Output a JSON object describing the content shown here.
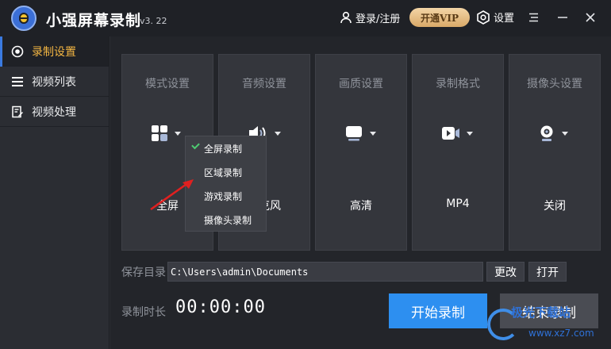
{
  "app": {
    "name": "小强屏幕录制",
    "version": "v3. 22"
  },
  "header": {
    "login": "登录/注册",
    "vip": "开通VIP",
    "settings": "设置"
  },
  "sidebar": {
    "items": [
      {
        "label": "录制设置",
        "icon": "record-circle-icon",
        "active": true
      },
      {
        "label": "视频列表",
        "icon": "list-icon",
        "active": false
      },
      {
        "label": "视频处理",
        "icon": "edit-doc-icon",
        "active": false
      }
    ]
  },
  "cards": [
    {
      "title": "模式设置",
      "value": "全屏",
      "icon": "grid-icon"
    },
    {
      "title": "音频设置",
      "value": "麦克风",
      "icon": "speaker-icon"
    },
    {
      "title": "画质设置",
      "value": "高清",
      "icon": "screen-icon"
    },
    {
      "title": "录制格式",
      "value": "MP4",
      "icon": "video-icon"
    },
    {
      "title": "摄像头设置",
      "value": "关闭",
      "icon": "webcam-icon"
    }
  ],
  "mode_dropdown": {
    "options": [
      "全屏录制",
      "区域录制",
      "游戏录制",
      "摄像头录制"
    ],
    "selected": "全屏录制"
  },
  "save": {
    "label": "保存目录",
    "path": "C:\\Users\\admin\\Documents",
    "change": "更改",
    "open": "打开"
  },
  "timer": {
    "label": "录制时长",
    "value": "00:00:00"
  },
  "actions": {
    "start": "开始录制",
    "stop": "结束录制"
  },
  "watermark": {
    "text": "极光下载站",
    "url": "www.xz7.com"
  },
  "colors": {
    "accent": "#2d8ff0",
    "active_text": "#f2b542",
    "vip": "#d9a968",
    "check": "#4ecb71",
    "annotation": "#e02020"
  }
}
